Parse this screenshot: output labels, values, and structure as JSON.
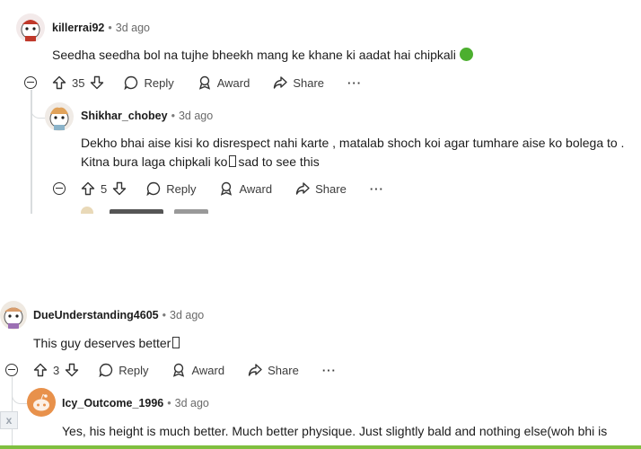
{
  "comments": [
    {
      "username": "killerrai92",
      "time": "3d ago",
      "text": "Seedha seedha bol na tujhe bheekh mang ke khane ki aadat hai chipkali",
      "votes": "35",
      "reply": "Reply",
      "award": "Award",
      "share": "Share",
      "more": "···"
    },
    {
      "username": "Shikhar_chobey",
      "time": "3d ago",
      "text_line1": "Dekho bhai aise kisi ko disrespect nahi karte , matalab shoch koi agar tumhare aise ko bolega to .",
      "text_line2a": "Kitna bura laga chipkali ko",
      "text_line2b": "sad to see this",
      "votes": "5",
      "reply": "Reply",
      "award": "Award",
      "share": "Share",
      "more": "···"
    },
    {
      "username": "DueUnderstanding4605",
      "time": "3d ago",
      "text": "This guy deserves better",
      "votes": "3",
      "reply": "Reply",
      "award": "Award",
      "share": "Share",
      "more": "···"
    },
    {
      "username": "Icy_Outcome_1996",
      "time": "3d ago",
      "text": "Yes, his height is much better. Much better physique. Just slightly bald and nothing else(woh bhi is"
    }
  ],
  "colors": {
    "thread_line": "#d9dcde",
    "orange_avatar": "#e8914b",
    "emoji_green": "#4caf2f"
  }
}
